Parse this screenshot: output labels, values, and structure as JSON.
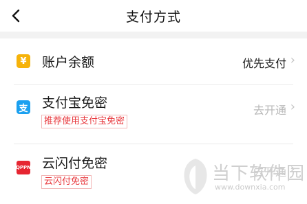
{
  "header": {
    "title": "支付方式",
    "back_icon": "back-arrow-icon"
  },
  "methods": [
    {
      "icon": "balance-icon",
      "icon_glyph": "¥",
      "label": "账户余额",
      "tag": "",
      "action": "优先支付"
    },
    {
      "icon": "alipay-icon",
      "icon_glyph": "支",
      "label": "支付宝免密",
      "tag": "推荐使用支付宝免密",
      "action": "去开通"
    },
    {
      "icon": "unionpay-icon",
      "icon_glyph": "QPPN",
      "label": "云闪付免密",
      "tag": "云闪付免密",
      "action": "去开通"
    }
  ],
  "watermark": {
    "text": "当下软件园",
    "url": "www.downxia.com"
  }
}
